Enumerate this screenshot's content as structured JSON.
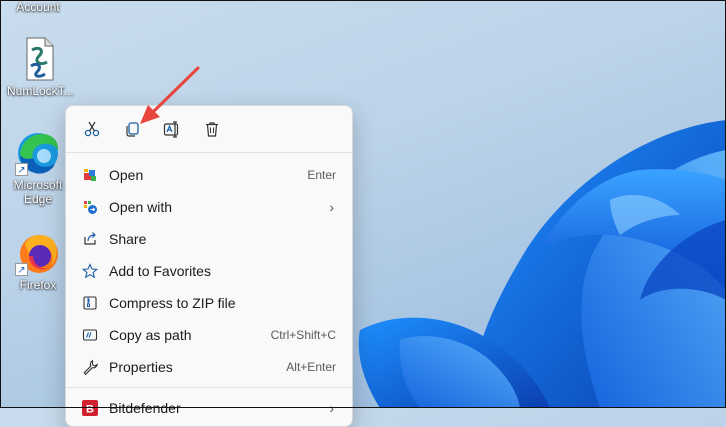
{
  "desktop": {
    "icons": [
      {
        "label": "Account"
      },
      {
        "label": "NumLockT..."
      },
      {
        "label": "Microsoft Edge"
      },
      {
        "label": "Firefox"
      }
    ]
  },
  "context_menu": {
    "toolbar": [
      {
        "name": "cut",
        "icon": "scissors-icon"
      },
      {
        "name": "copy",
        "icon": "copy-icon"
      },
      {
        "name": "rename",
        "icon": "rename-icon"
      },
      {
        "name": "delete",
        "icon": "trash-icon"
      }
    ],
    "items": [
      {
        "label": "Open",
        "shortcut": "Enter"
      },
      {
        "label": "Open with",
        "submenu": true
      },
      {
        "label": "Share"
      },
      {
        "label": "Add to Favorites"
      },
      {
        "label": "Compress to ZIP file"
      },
      {
        "label": "Copy as path",
        "shortcut": "Ctrl+Shift+C"
      },
      {
        "label": "Properties",
        "shortcut": "Alt+Enter"
      },
      {
        "label": "Bitdefender",
        "submenu": true
      }
    ],
    "chevron": "›"
  },
  "colors": {
    "accent": "#0067c0",
    "annotation_arrow": "#e8453c",
    "bitdefender": "#d1202f"
  }
}
